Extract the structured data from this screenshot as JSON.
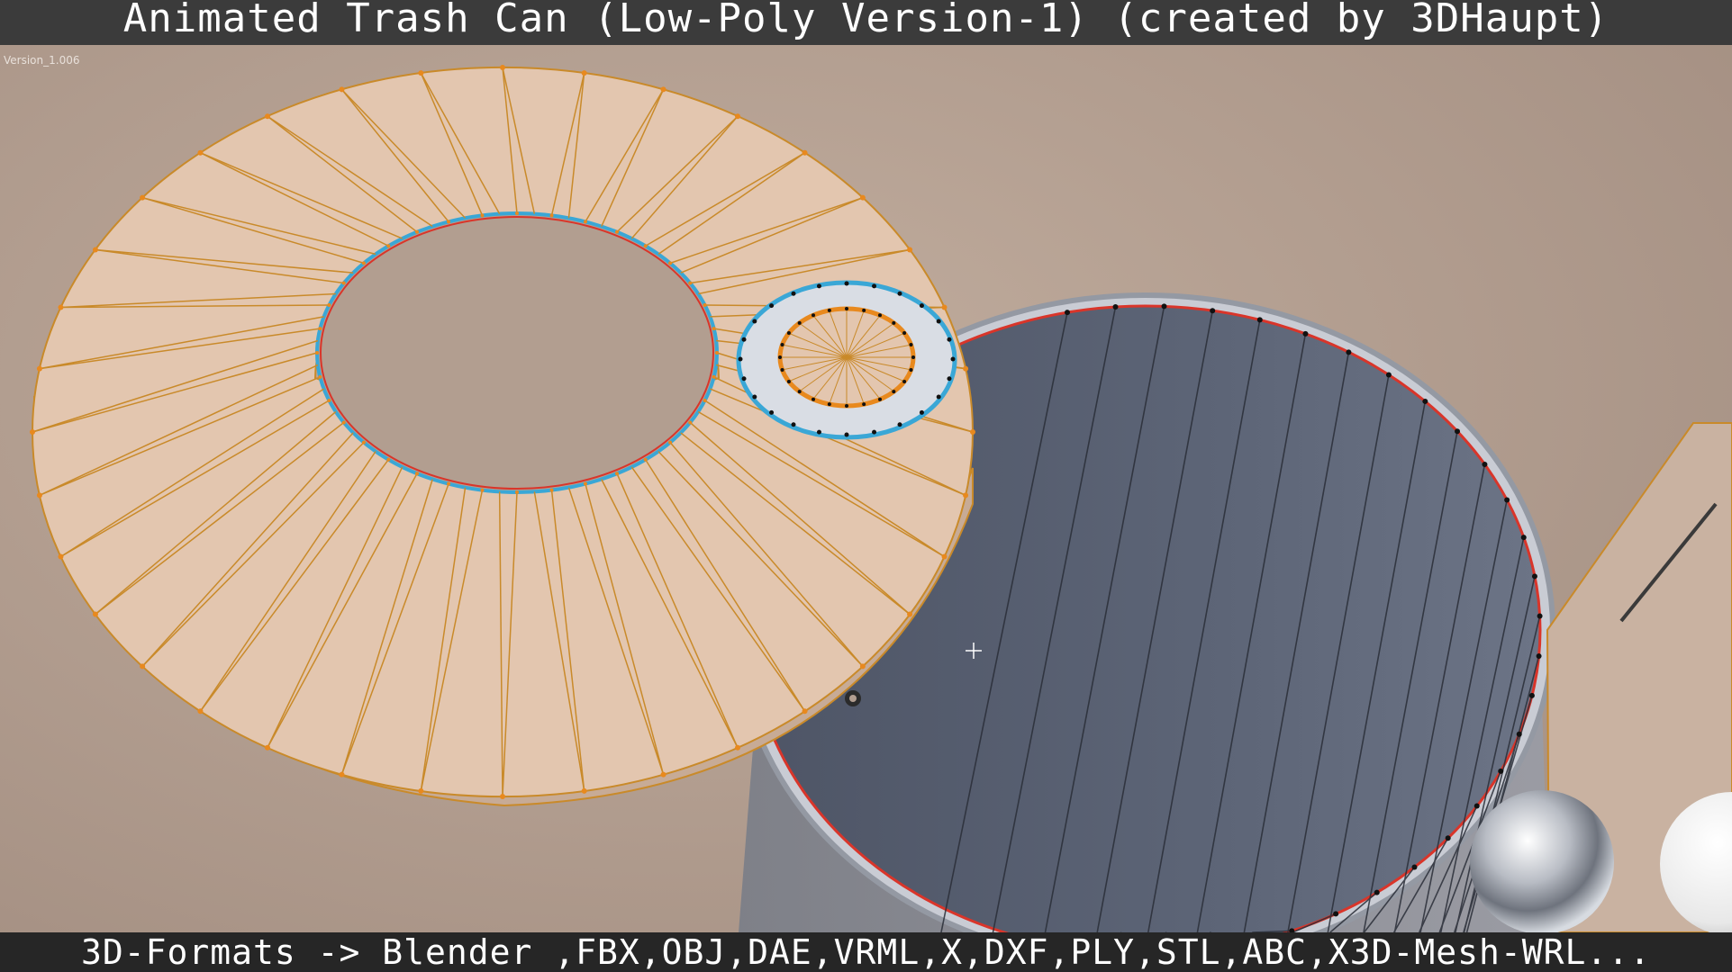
{
  "header": {
    "title": "Animated Trash Can (Low-Poly Version-1) (created by 3DHaupt)"
  },
  "viewport": {
    "version_label": "Version_1.006",
    "cursor_icon": "crosshair-icon",
    "colors": {
      "background": "#b29e90",
      "lid_surface": "#e3c6af",
      "wire_edge": "#c98a2a",
      "vertex": "#e8891e",
      "selected_edge": "#3aa7d6",
      "can_interior": "#5b6272",
      "rim_red": "#d9352a",
      "metal": "#c9ccd4"
    }
  },
  "footer": {
    "formats": "3D-Formats -> Blender ,FBX,OBJ,DAE,VRML,X,DXF,PLY,STL,ABC,X3D-Mesh-WRL..."
  }
}
